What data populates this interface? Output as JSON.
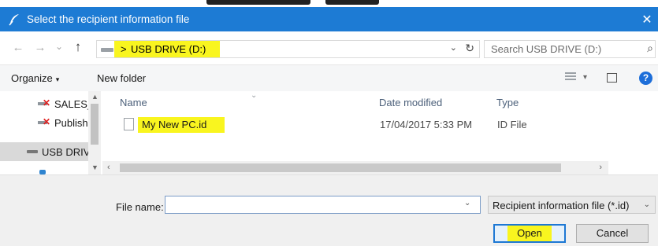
{
  "window": {
    "title": "Select the recipient information file",
    "close_glyph": "✕",
    "app_icon": "feather-pen-icon"
  },
  "navigation": {
    "back_glyph": "←",
    "forward_glyph": "→",
    "recent_glyph": "⌄",
    "up_glyph": "↑"
  },
  "address_bar": {
    "separator": ">",
    "location": "USB DRIVE (D:)",
    "dropdown_glyph": "⌄",
    "refresh_glyph": "↻"
  },
  "search": {
    "placeholder": "Search USB DRIVE (D:)",
    "icon_glyph": "⌕"
  },
  "toolbar": {
    "organize_label": "Organize",
    "organize_caret": "▾",
    "new_folder_label": "New folder",
    "view_caret": "▾",
    "help_glyph": "?"
  },
  "nav_pane": {
    "items": [
      {
        "label": "SALES_N",
        "icon": "network-drive-disconnected-icon"
      },
      {
        "label": "Publishe",
        "icon": "network-drive-disconnected-icon"
      },
      {
        "label": "USB DRIV",
        "icon": "usb-drive-icon",
        "selected": true
      }
    ],
    "scroll_up": "▲",
    "scroll_down": "▼"
  },
  "file_list": {
    "columns": [
      "Name",
      "Date modified",
      "Type"
    ],
    "sort_glyph": "⌄",
    "rows": [
      {
        "name": "My New PC.id",
        "date_modified": "17/04/2017 5:33 PM",
        "type": "ID File"
      }
    ],
    "scroll_left": "‹",
    "scroll_right": "›"
  },
  "footer": {
    "file_name_label": "File name:",
    "file_name_value": "",
    "file_name_dropdown": "⌄",
    "filter_selected": "Recipient information file (*.id)",
    "filter_caret": "⌄",
    "open_label": "Open",
    "cancel_label": "Cancel"
  },
  "colors": {
    "titlebar": "#1d7bd4",
    "highlight": "#f9f51f",
    "accent": "#1d78d4"
  }
}
